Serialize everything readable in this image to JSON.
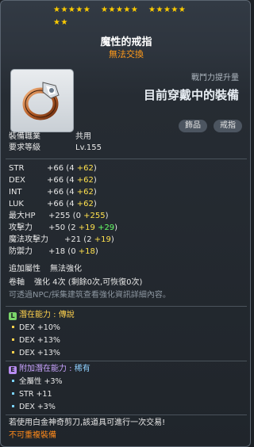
{
  "stars": {
    "row1": [
      "★★★★★",
      "★★★★★",
      "★★★★★"
    ],
    "row2": "★★"
  },
  "item": {
    "name": "魔性的戒指",
    "trade": "無法交換"
  },
  "compare": {
    "power_label": "戰鬥力提升量",
    "current_equipped": "目前穿戴中的裝備"
  },
  "tags": [
    "飾品",
    "戒指"
  ],
  "requirements": [
    {
      "label": "裝備職業",
      "value": "共用"
    },
    {
      "label": "要求等級",
      "value": "Lv.155"
    }
  ],
  "stats": [
    {
      "name": "STR",
      "total": "+66",
      "base": "4",
      "bonus": "+62"
    },
    {
      "name": "DEX",
      "total": "+66",
      "base": "4",
      "bonus": "+62"
    },
    {
      "name": "INT",
      "total": "+66",
      "base": "4",
      "bonus": "+62"
    },
    {
      "name": "LUK",
      "total": "+66",
      "base": "4",
      "bonus": "+62"
    },
    {
      "name": "最大HP",
      "total": "+255",
      "base": "0",
      "bonus": "+255"
    },
    {
      "name": "攻擊力",
      "total": "+50",
      "base": "2",
      "bonus": "+19",
      "bonus2": "+29"
    },
    {
      "name": "魔法攻擊力",
      "total": "+21",
      "base": "2",
      "bonus": "+19"
    },
    {
      "name": "防禦力",
      "total": "+18",
      "base": "0",
      "bonus": "+18"
    }
  ],
  "extra": {
    "attr_label": "追加屬性",
    "attr_value": "無法強化",
    "scroll_label": "卷軸",
    "scroll_value": "強化 4次 (剩餘0次,可恢復0次)",
    "note": "可透過NPC/採集建筑查看強化資訊詳細內容。"
  },
  "potential": {
    "icon": "L",
    "label": "潛在能力",
    "grade": "傳說",
    "lines": [
      "DEX +10%",
      "DEX +13%",
      "DEX +13%"
    ]
  },
  "additional": {
    "icon": "E",
    "label": "附加潛在能力",
    "grade": "稀有",
    "lines": [
      "全屬性 +3%",
      "STR +11",
      "DEX +3%"
    ]
  },
  "footer": {
    "line1": "若使用白金神奇剪刀,該道具可進行一次交易!",
    "line2": "不可重複裝備"
  },
  "colors": {
    "stars": "#ffcc00",
    "bonus": "#ffe14d",
    "flame": "#66ff66",
    "legend": "#ffd24d",
    "rare": "#7ad3ff",
    "warn": "#ff8a1a"
  }
}
